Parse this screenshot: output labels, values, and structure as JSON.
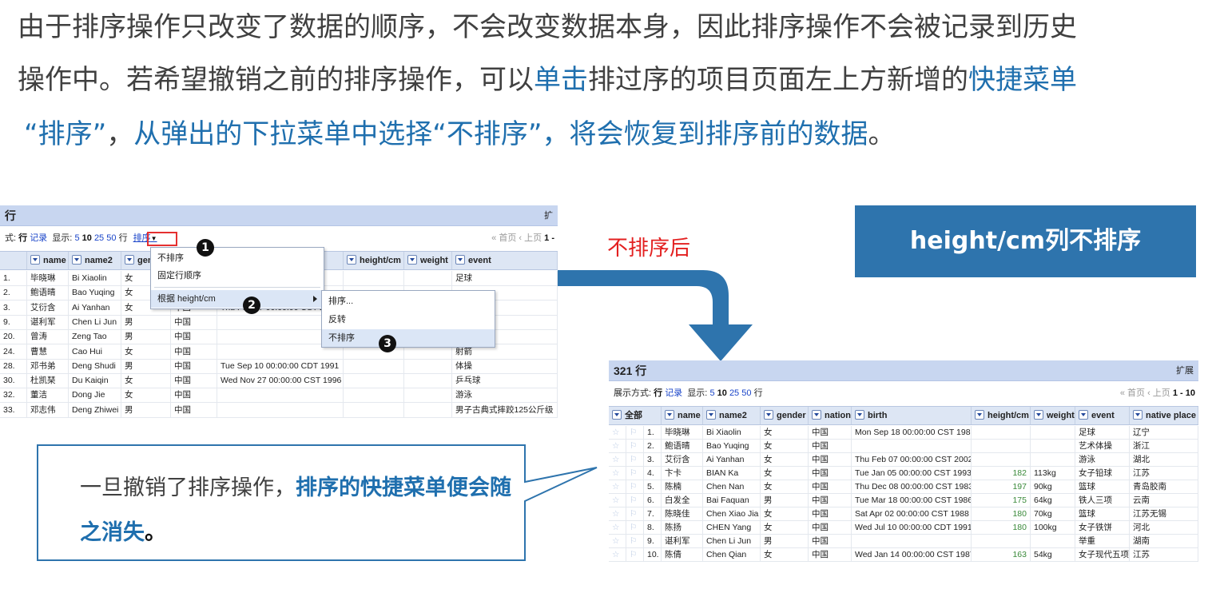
{
  "paragraph": {
    "line1": "由于排序操作只改变了数据的顺序，不会改变数据本身，因此排序操作不会被记录到历史",
    "line2_a": "操作中。若希望撤销之前的排序操作，可以",
    "line2_b": "单击",
    "line2_c": "排过序的项目页面左上方新增的",
    "line2_d": "快捷菜单",
    "line3_a": "“排序”",
    "line3_b": "，",
    "line3_c": "从弹出的下拉菜单中选择“不排序”，将会恢复到排序前的数据",
    "line3_d": "。"
  },
  "after_label": "不排序后",
  "title_box": "height/cm列不排序",
  "callout": {
    "text_a": "一旦撤销了排序操作，",
    "text_b": "排序的快捷菜单便会随之消失",
    "text_c": "。"
  },
  "left_screen": {
    "title": "行",
    "title_right": "扩",
    "toolbar": {
      "prefix": "式:",
      "mode_rows": "行",
      "mode_records": "记录",
      "show_label": "显示:",
      "sizes": [
        "5",
        "10",
        "25",
        "50"
      ],
      "rows_label": "行",
      "sort_menu": "排序",
      "pager": "« 首页 ‹ 上页",
      "page_range": "1 -"
    },
    "columns": [
      "name",
      "name2",
      "gen",
      "height/cm",
      "weight",
      "event"
    ],
    "rows": [
      {
        "idx": "1.",
        "name": "毕晓琳",
        "name2": "Bi Xiaolin",
        "gender": "女",
        "nation": "",
        "birth": "1989",
        "height": "",
        "weight": "",
        "event": "足球"
      },
      {
        "idx": "2.",
        "name": "鲍语晴",
        "name2": "Bao Yuqing",
        "gender": "女",
        "nation": "",
        "birth": "",
        "height": "",
        "weight": "",
        "event": ""
      },
      {
        "idx": "3.",
        "name": "艾衍含",
        "name2": "Ai Yanhan",
        "gender": "女",
        "nation": "中国",
        "birth": "Thu Feb 07 00:00:00 CST 2",
        "height": "",
        "weight": "",
        "event": ""
      },
      {
        "idx": "9.",
        "name": "谌利军",
        "name2": "Chen Li Jun",
        "gender": "男",
        "nation": "中国",
        "birth": "",
        "height": "",
        "weight": "",
        "event": ""
      },
      {
        "idx": "20.",
        "name": "曾涛",
        "name2": "Zeng Tao",
        "gender": "男",
        "nation": "中国",
        "birth": "",
        "height": "",
        "weight": "",
        "event": ""
      },
      {
        "idx": "24.",
        "name": "曹慧",
        "name2": "Cao Hui",
        "gender": "女",
        "nation": "中国",
        "birth": "",
        "height": "",
        "weight": "",
        "event": "射箭"
      },
      {
        "idx": "28.",
        "name": "邓书弟",
        "name2": "Deng Shudi",
        "gender": "男",
        "nation": "中国",
        "birth": "Tue Sep 10 00:00:00 CDT 1991",
        "height": "",
        "weight": "",
        "event": "体操"
      },
      {
        "idx": "30.",
        "name": "杜凯琹",
        "name2": "Du Kaiqin",
        "gender": "女",
        "nation": "中国",
        "birth": "Wed Nov 27 00:00:00 CST 1996",
        "height": "",
        "weight": "",
        "event": "乒乓球"
      },
      {
        "idx": "32.",
        "name": "董洁",
        "name2": "Dong Jie",
        "gender": "女",
        "nation": "中国",
        "birth": "",
        "height": "",
        "weight": "",
        "event": "游泳"
      },
      {
        "idx": "33.",
        "name": "邓志伟",
        "name2": "Deng Zhiwei",
        "gender": "男",
        "nation": "中国",
        "birth": "",
        "height": "",
        "weight": "",
        "event": "男子古典式摔跤125公斤级"
      }
    ],
    "menu1": {
      "items": [
        "不排序",
        "固定行顺序",
        "根据 height/cm"
      ]
    },
    "menu2": {
      "items": [
        "排序...",
        "反转",
        "不排序"
      ]
    },
    "badges": [
      "1",
      "2",
      "3"
    ]
  },
  "right_screen": {
    "title": "321 行",
    "title_right": "扩展",
    "toolbar": {
      "prefix": "展示方式:",
      "mode_rows": "行",
      "mode_records": "记录",
      "show_label": "显示:",
      "sizes": [
        "5",
        "10",
        "25",
        "50"
      ],
      "rows_label": "行",
      "pager": "« 首页 ‹ 上页",
      "page_range": "1 - 10"
    },
    "columns": [
      "全部",
      "name",
      "name2",
      "gender",
      "nation",
      "birth",
      "height/cm",
      "weight",
      "event",
      "native place"
    ],
    "rows": [
      {
        "idx": "1.",
        "name": "毕晓琳",
        "name2": "Bi Xiaolin",
        "gender": "女",
        "nation": "中国",
        "birth": "Mon Sep 18 00:00:00 CST 1989",
        "height": "",
        "weight": "",
        "event": "足球",
        "place": "辽宁"
      },
      {
        "idx": "2.",
        "name": "鲍语晴",
        "name2": "Bao Yuqing",
        "gender": "女",
        "nation": "中国",
        "birth": "",
        "height": "",
        "weight": "",
        "event": "艺术体操",
        "place": "浙江"
      },
      {
        "idx": "3.",
        "name": "艾衍含",
        "name2": "Ai Yanhan",
        "gender": "女",
        "nation": "中国",
        "birth": "Thu Feb 07 00:00:00 CST 2002",
        "height": "",
        "weight": "",
        "event": "游泳",
        "place": "湖北"
      },
      {
        "idx": "4.",
        "name": "卞卡",
        "name2": "BIAN Ka",
        "gender": "女",
        "nation": "中国",
        "birth": "Tue Jan 05 00:00:00 CST 1993",
        "height": "182",
        "weight": "113kg",
        "event": "女子铅球",
        "place": "江苏"
      },
      {
        "idx": "5.",
        "name": "陈楠",
        "name2": "Chen Nan",
        "gender": "女",
        "nation": "中国",
        "birth": "Thu Dec 08 00:00:00 CST 1983",
        "height": "197",
        "weight": "90kg",
        "event": "篮球",
        "place": "青岛胶南"
      },
      {
        "idx": "6.",
        "name": "白发全",
        "name2": "Bai Faquan",
        "gender": "男",
        "nation": "中国",
        "birth": "Tue Mar 18 00:00:00 CST 1986",
        "height": "175",
        "weight": "64kg",
        "event": "铁人三项",
        "place": "云南"
      },
      {
        "idx": "7.",
        "name": "陈晓佳",
        "name2": "Chen Xiao Jia",
        "gender": "女",
        "nation": "中国",
        "birth": "Sat Apr 02 00:00:00 CST 1988",
        "height": "180",
        "weight": "70kg",
        "event": "篮球",
        "place": "江苏无锡"
      },
      {
        "idx": "8.",
        "name": "陈扬",
        "name2": "CHEN Yang",
        "gender": "女",
        "nation": "中国",
        "birth": "Wed Jul 10 00:00:00 CDT 1991",
        "height": "180",
        "weight": "100kg",
        "event": "女子铁饼",
        "place": "河北"
      },
      {
        "idx": "9.",
        "name": "谌利军",
        "name2": "Chen Li Jun",
        "gender": "男",
        "nation": "中国",
        "birth": "",
        "height": "",
        "weight": "",
        "event": "举重",
        "place": "湖南"
      },
      {
        "idx": "10.",
        "name": "陈倩",
        "name2": "Chen Qian",
        "gender": "女",
        "nation": "中国",
        "birth": "Wed Jan 14 00:00:00 CST 1987",
        "height": "163",
        "weight": "54kg",
        "event": "女子现代五项",
        "place": "江苏"
      }
    ]
  },
  "colors": {
    "accent_blue": "#2e74ad",
    "text_blue": "#1f6fae",
    "red": "#e32020",
    "header_bg": "#c8d6f0"
  }
}
